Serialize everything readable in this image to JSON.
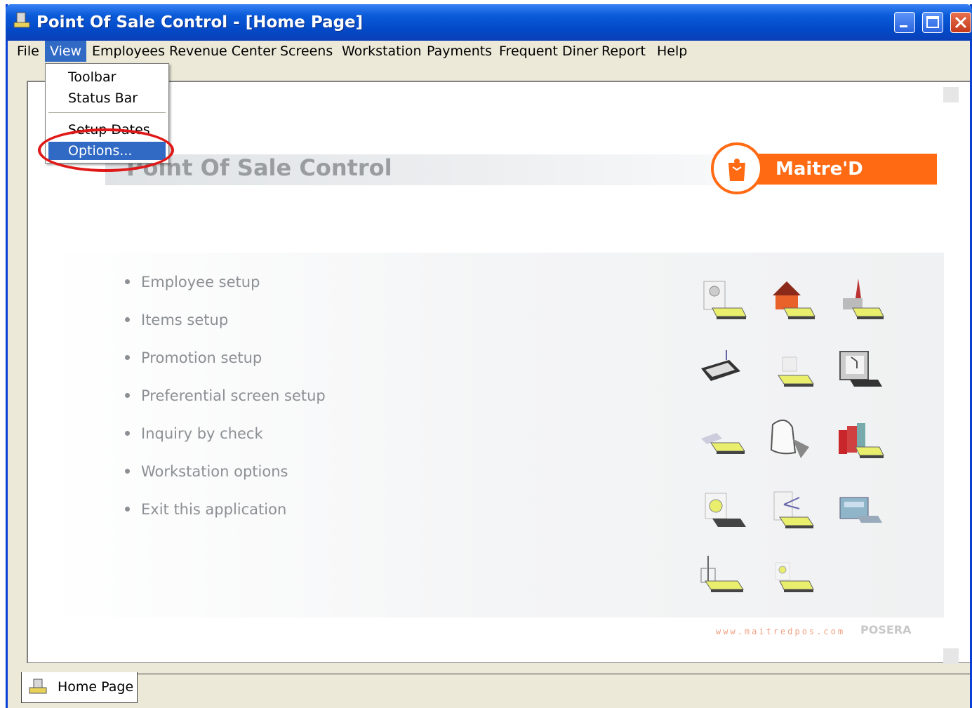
{
  "window": {
    "title": "Point Of Sale Control - [Home Page]"
  },
  "menubar": {
    "items": [
      "File",
      "View",
      "Employees",
      "Revenue Center",
      "Screens",
      "Workstation",
      "Payments",
      "Frequent Diner",
      "Report",
      "Help"
    ],
    "active_item": "View"
  },
  "view_menu": {
    "items": [
      "Toolbar",
      "Status Bar",
      "Setup Dates",
      "Options..."
    ],
    "highlighted_item": "Options..."
  },
  "home": {
    "header": "Point Of Sale Control",
    "brand": "Maitre'D",
    "links": [
      "Employee setup",
      "Items setup",
      "Promotion setup",
      "Preferential screen setup",
      "Inquiry by check",
      "Workstation options",
      "Exit this application"
    ],
    "website": "www.maitredpos.com",
    "partner_logo": "POSERA"
  },
  "tabs": {
    "home_tab": "Home Page"
  },
  "icons": [
    "employee-icon",
    "house-icon",
    "revenue-center-icon",
    "keyboard-icon",
    "scale-icon",
    "monitor-icon",
    "hand-icon",
    "paper-roll-icon",
    "books-icon",
    "cd-icon",
    "network-icon",
    "printer-icon",
    "tower-icon",
    "disc-icon"
  ],
  "colors": {
    "title_bar": "#0349c7",
    "menu_highlight": "#316ac5",
    "brand_orange": "#ff6a13",
    "annotation_red": "#e01818"
  }
}
